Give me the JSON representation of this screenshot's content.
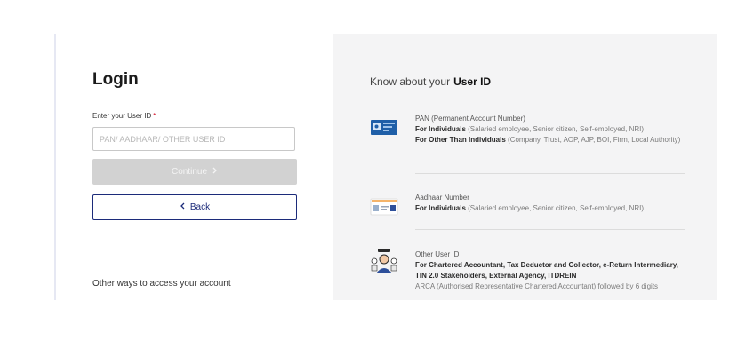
{
  "login": {
    "title": "Login",
    "user_id_label": "Enter your User ID",
    "required_mark": "*",
    "user_id_value": "",
    "user_id_placeholder": "PAN/ AADHAAR/ OTHER USER ID",
    "continue_label": "Continue",
    "continue_icon": "chevron-right-icon",
    "back_label": "Back",
    "back_icon": "chevron-left-icon",
    "other_ways": "Other ways to access your account"
  },
  "info": {
    "heading_prefix": "Know about your",
    "heading_strong": "User ID",
    "items": [
      {
        "icon": "pan-card-icon",
        "name": "PAN (Permanent Account Number)",
        "line1_bold": "For Individuals",
        "line1_rest": "(Salaried employee, Senior citizen, Self-employed, NRI)",
        "line2_bold": "For Other Than Individuals",
        "line2_rest": "(Company, Trust, AOP, AJP, BOI, Firm, Local Authority)"
      },
      {
        "icon": "aadhaar-card-icon",
        "name": "Aadhaar Number",
        "line1_bold": "For Individuals",
        "line1_rest": "(Salaried employee, Senior citizen, Self-employed, NRI)"
      },
      {
        "icon": "user-group-icon",
        "name": "Other User ID",
        "line1_bold": "For Chartered Accountant, Tax Deductor and Collector, e-Return Intermediary, TIN 2.0 Stakeholders, External Agency, ITDREIN",
        "line2_rest": "ARCA (Authorised Representative Chartered Accountant) followed by 6 digits"
      }
    ]
  },
  "colors": {
    "primary": "#1c2b7a",
    "disabled_button": "#d2d2d2",
    "panel_bg": "#f4f4f5",
    "required": "#d0021b"
  }
}
